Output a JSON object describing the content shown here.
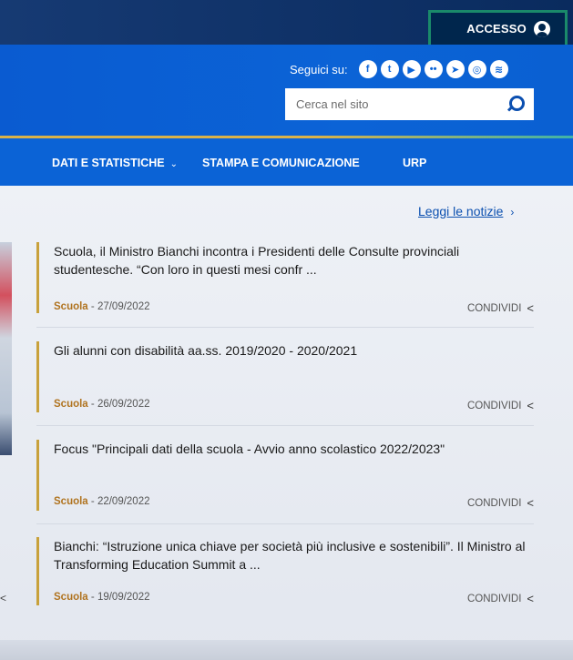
{
  "topbar": {
    "login_label": "ACCESSO"
  },
  "header": {
    "social_label": "Seguici su:",
    "social_icons": [
      "facebook-icon",
      "twitter-icon",
      "youtube-icon",
      "flickr-icon",
      "telegram-icon",
      "instagram-icon",
      "spotify-icon"
    ],
    "search_placeholder": "Cerca nel sito"
  },
  "nav": {
    "items": [
      "DATI E STATISTICHE",
      "STAMPA E COMUNICAZIONE",
      "URP"
    ]
  },
  "news": {
    "read_more": "Leggi le notizie",
    "share_label": "CONDIVIDI",
    "items": [
      {
        "title": "Scuola, il Ministro Bianchi incontra i Presidenti delle Consulte provinciali studentesche. “Con loro in questi mesi confr ...",
        "category": "Scuola",
        "date": " - 27/09/2022"
      },
      {
        "title": "Gli alunni con disabilità aa.ss. 2019/2020 - 2020/2021",
        "category": "Scuola",
        "date": " - 26/09/2022"
      },
      {
        "title": "Focus \"Principali dati della scuola - Avvio anno scolastico 2022/2023\"",
        "category": "Scuola",
        "date": " - 22/09/2022"
      },
      {
        "title": "Bianchi: “Istruzione unica chiave per società più inclusive e sostenibili”. Il Ministro al Transforming Education Summit a ...",
        "category": "Scuola",
        "date": " - 19/09/2022"
      }
    ]
  },
  "colors": {
    "primary": "#0b63d6",
    "dark": "#00264d",
    "accent": "#c8a13b"
  }
}
